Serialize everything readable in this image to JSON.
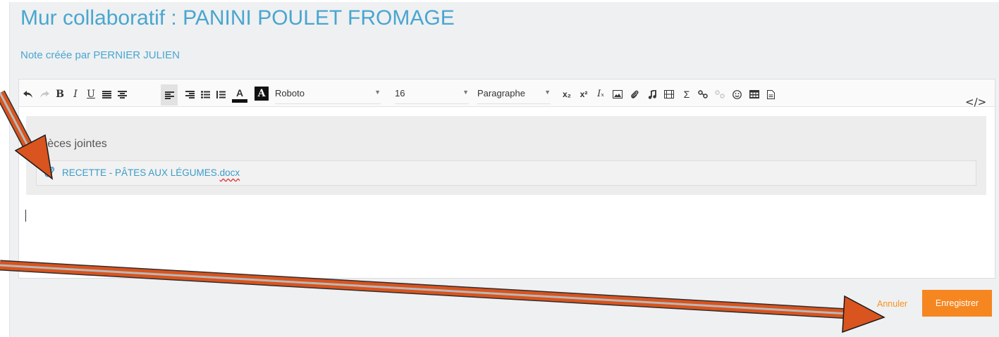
{
  "page": {
    "title": "Mur collaboratif : PANINI POULET FROMAGE",
    "subtitle": "Note créée par PERNIER JULIEN"
  },
  "toolbar": {
    "buttons": [
      "undo-icon",
      "redo-icon",
      "bold-icon",
      "italic-icon",
      "underline-icon",
      "align-justify-icon",
      "align-center-icon",
      "align-left-icon",
      "align-right-icon",
      "bullet-list-icon",
      "numbered-list-icon",
      "text-color-icon",
      "background-color-icon"
    ],
    "bold_label": "B",
    "italic_label": "I",
    "underline_label": "U",
    "text_color_label": "A",
    "bg_color_label": "A",
    "font_family": "Roboto",
    "font_size": "16",
    "paragraph_format": "Paragraphe",
    "subscript_label": "x₂",
    "superscript_label": "x²",
    "clear_format_label": "Iₓ",
    "formula_label": "Σ",
    "code_view_label": "</>"
  },
  "attachments": {
    "title": "Pièces jointes",
    "file_name": "RECETTE - PÂTES AUX LÉGUMES.",
    "file_ext": "docx"
  },
  "actions": {
    "cancel_label": "Annuler",
    "save_label": "Enregistrer"
  },
  "colors": {
    "accent": "#49a6cf",
    "save_button": "#f6861f",
    "annotation_arrow": "#d9541e"
  }
}
